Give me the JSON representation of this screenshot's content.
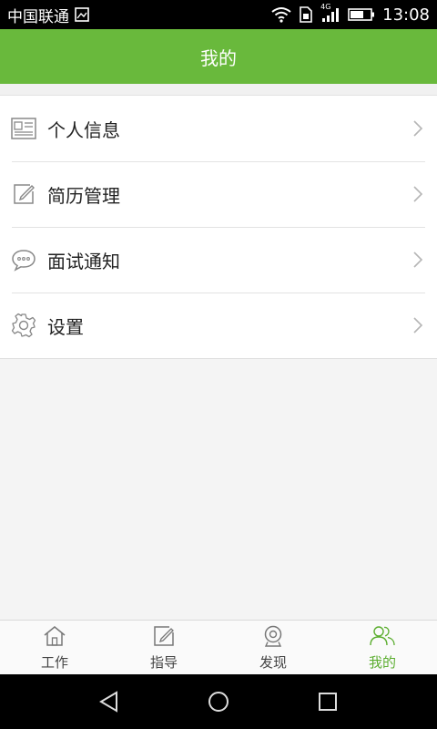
{
  "status_bar": {
    "carrier": "中国联通",
    "network": "4G",
    "time": "13:08",
    "icons": [
      "image-icon",
      "wifi-icon",
      "sim-icon",
      "signal-icon",
      "battery-icon"
    ]
  },
  "app_bar": {
    "title": "我的"
  },
  "menu": {
    "items": [
      {
        "label": "个人信息",
        "icon": "profile-card-icon"
      },
      {
        "label": "简历管理",
        "icon": "edit-icon"
      },
      {
        "label": "面试通知",
        "icon": "chat-bubble-icon"
      },
      {
        "label": "设置",
        "icon": "gear-icon"
      }
    ]
  },
  "tab_bar": {
    "active": "我的",
    "active_color": "#5cae30",
    "tabs": [
      {
        "label": "工作",
        "icon": "home-icon"
      },
      {
        "label": "指导",
        "icon": "edit-icon"
      },
      {
        "label": "发现",
        "icon": "webcam-icon"
      },
      {
        "label": "我的",
        "icon": "users-icon"
      }
    ]
  },
  "colors": {
    "brand_green": "#69b93c"
  }
}
